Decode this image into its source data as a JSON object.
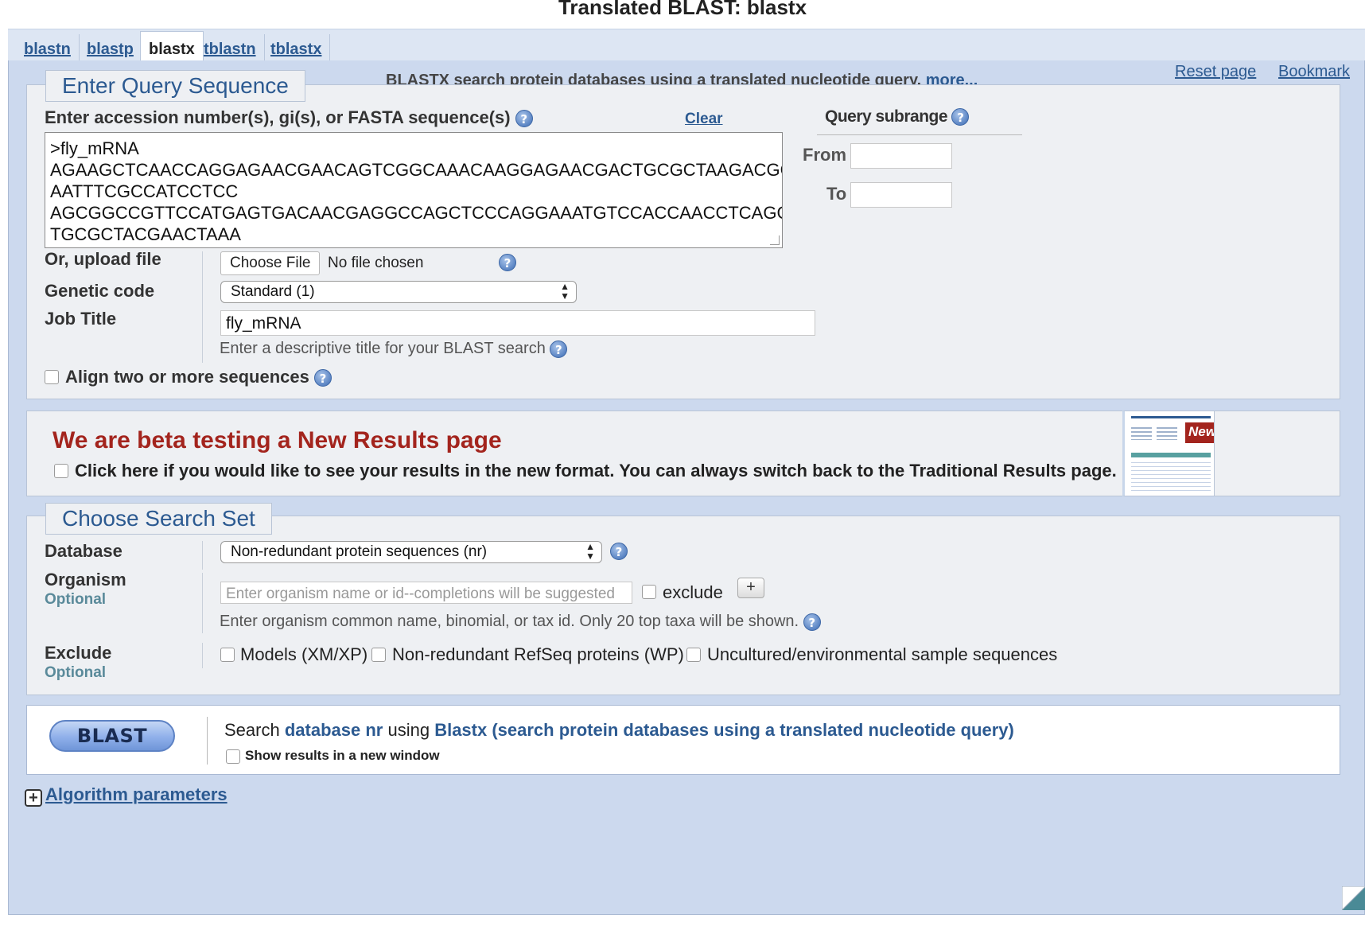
{
  "page": {
    "title": "Translated BLAST: blastx"
  },
  "tabs": [
    {
      "label": "blastn"
    },
    {
      "label": "blastp"
    },
    {
      "label": "blastx",
      "active": true
    },
    {
      "label": "tblastn"
    },
    {
      "label": "tblastx"
    }
  ],
  "header": {
    "description": "BLASTX search protein databases using a translated nucleotide query.",
    "more_link": "more...",
    "reset_link": "Reset page",
    "bookmark_link": "Bookmark"
  },
  "query": {
    "legend": "Enter Query Sequence",
    "sequence_label": "Enter accession number(s), gi(s), or FASTA sequence(s)",
    "clear_link": "Clear",
    "sequence_value": ">fly_mRNA\nAGAAGCTCAACCAGGAGAACGAACAGTCGGCAAACAAGGAGAACGACTGCGCTAAGACGGT\nAATTTCGCCATCCTCC\nAGCGGCCGTTCCATGAGTGACAACGAGGCCAGCTCCCAGGAAATGTCCACCAACCTCAGGG\nTGCGCTACGAACTAAA",
    "subrange_label": "Query subrange",
    "from_label": "From",
    "to_label": "To",
    "from_value": "",
    "to_value": "",
    "upload_label": "Or, upload file",
    "choose_file_label": "Choose File",
    "no_file_text": "No file chosen",
    "genetic_code_label": "Genetic code",
    "genetic_code_value": "Standard (1)",
    "job_title_label": "Job Title",
    "job_title_value": "fly_mRNA",
    "job_title_hint": "Enter a descriptive title for your BLAST search",
    "align_label": "Align two or more sequences",
    "align_checked": false
  },
  "beta": {
    "title": "We are beta testing a New Results page",
    "text": "Click here if you would like to see your results in the new format. You can always switch back to the Traditional Results page.",
    "badge": "New",
    "checked": false
  },
  "search_set": {
    "legend": "Choose Search Set",
    "database_label": "Database",
    "database_value": "Non-redundant protein sequences (nr)",
    "organism_label": "Organism",
    "optional_label": "Optional",
    "organism_placeholder": "Enter organism name or id--completions will be suggested",
    "exclude_checkbox_label": "exclude",
    "add_button": "+",
    "organism_hint": "Enter organism common name, binomial, or tax id. Only 20 top taxa will be shown.",
    "exclude_label": "Exclude",
    "exclude_optional": "Optional",
    "exclude_options": [
      {
        "label": "Models (XM/XP)",
        "checked": false
      },
      {
        "label": "Non-redundant RefSeq proteins (WP)",
        "checked": false
      },
      {
        "label": "Uncultured/environmental sample sequences",
        "checked": false
      }
    ]
  },
  "submit": {
    "button_label": "BLAST",
    "search_prefix": "Search",
    "database_text": "database nr",
    "using_text": "using",
    "program_text": "Blastx (search protein databases using a translated nucleotide query)",
    "new_window_label": "Show results in a new window",
    "new_window_checked": false
  },
  "algorithm": {
    "label": "Algorithm parameters"
  },
  "colors": {
    "link": "#2c5a91",
    "beta_title": "#a3241d",
    "main_bg": "#ccd9ee",
    "panel_bg": "#eef0f3"
  }
}
